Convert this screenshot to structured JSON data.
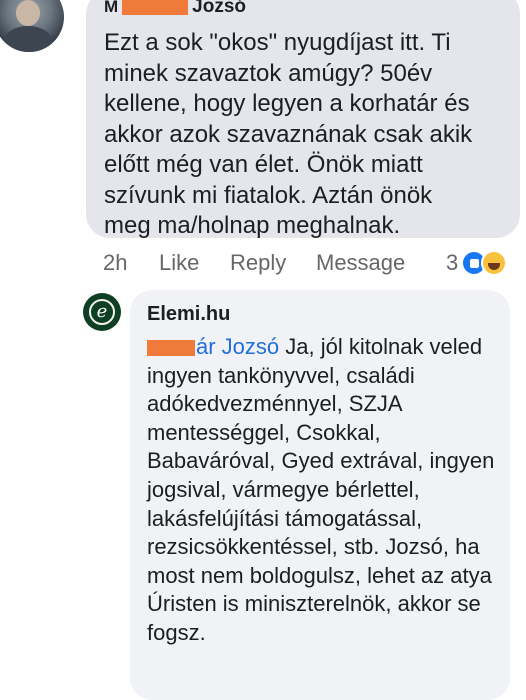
{
  "comment1": {
    "author_initial": "M",
    "author_name": "Jozsó",
    "text": "Ezt a sok \"okos\" nyugdíjast itt. Ti\nminek szavaztok amúgy? 50év\nkellene, hogy legyen a korhatár és\nakkor azok szavaznának csak akik\nelőtt még van élet. Önök miatt\nszívunk mi fiatalok. Aztán önök\nmeg ma/holnap meghalnak.",
    "actions": {
      "time": "2h",
      "like": "Like",
      "reply": "Reply",
      "message": "Message"
    },
    "reaction_count": "3",
    "reaction_icons": [
      "like-icon",
      "haha-icon"
    ]
  },
  "comment2": {
    "author_name": "Elemi.hu",
    "mention_suffix": "ár Jozsó",
    "text": " Ja, jól kitolnak veled ingyen tankönyvvel, családi adókedvezménnyel, SZJA mentességgel, Csokkal, Babaváróval, Gyed extrával, ingyen jogsival, vármegye bérlettel, lakásfelújítási támogatással, rezsicsökkentéssel, stb. Jozsó, ha most nem boldogulsz, lehet az atya Úristen is miniszterelnök, akkor se fogsz.",
    "redaction_color": "#f07a3a"
  },
  "colors": {
    "bubble_dark": "#e4e6eb",
    "bubble_light": "#f0f2f5",
    "mention": "#216fdb",
    "meta_text": "#65676b",
    "like_blue": "#1877f2",
    "haha_yellow": "#f7c23c",
    "avatar_green": "#0e3f23"
  }
}
